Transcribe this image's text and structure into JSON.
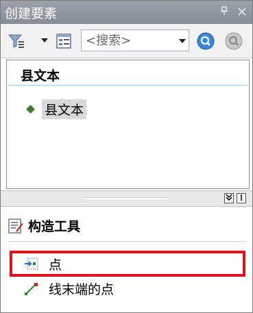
{
  "window": {
    "title": "创建要素",
    "pin_glyph": "ᵦ",
    "close_glyph": "✕"
  },
  "toolbar": {
    "search_placeholder": "<搜索>",
    "icons": [
      "filter-icon",
      "organize-templates-icon",
      "search-icon",
      "clear-search-icon"
    ]
  },
  "templates": {
    "group_header": "县文本",
    "items": [
      {
        "label": "县文本",
        "selected": true
      }
    ]
  },
  "splitter": {
    "collapse_glyph": "¥",
    "info_glyph": "|"
  },
  "construction_tools": {
    "title": "构造工具",
    "items": [
      {
        "label": "点",
        "highlighted": true
      },
      {
        "label": "线末端的点",
        "highlighted": false
      }
    ]
  },
  "colors": {
    "titlebar": "#8f96a0",
    "highlight": "#e0101a",
    "template_symbol": "#3c7a2a"
  }
}
